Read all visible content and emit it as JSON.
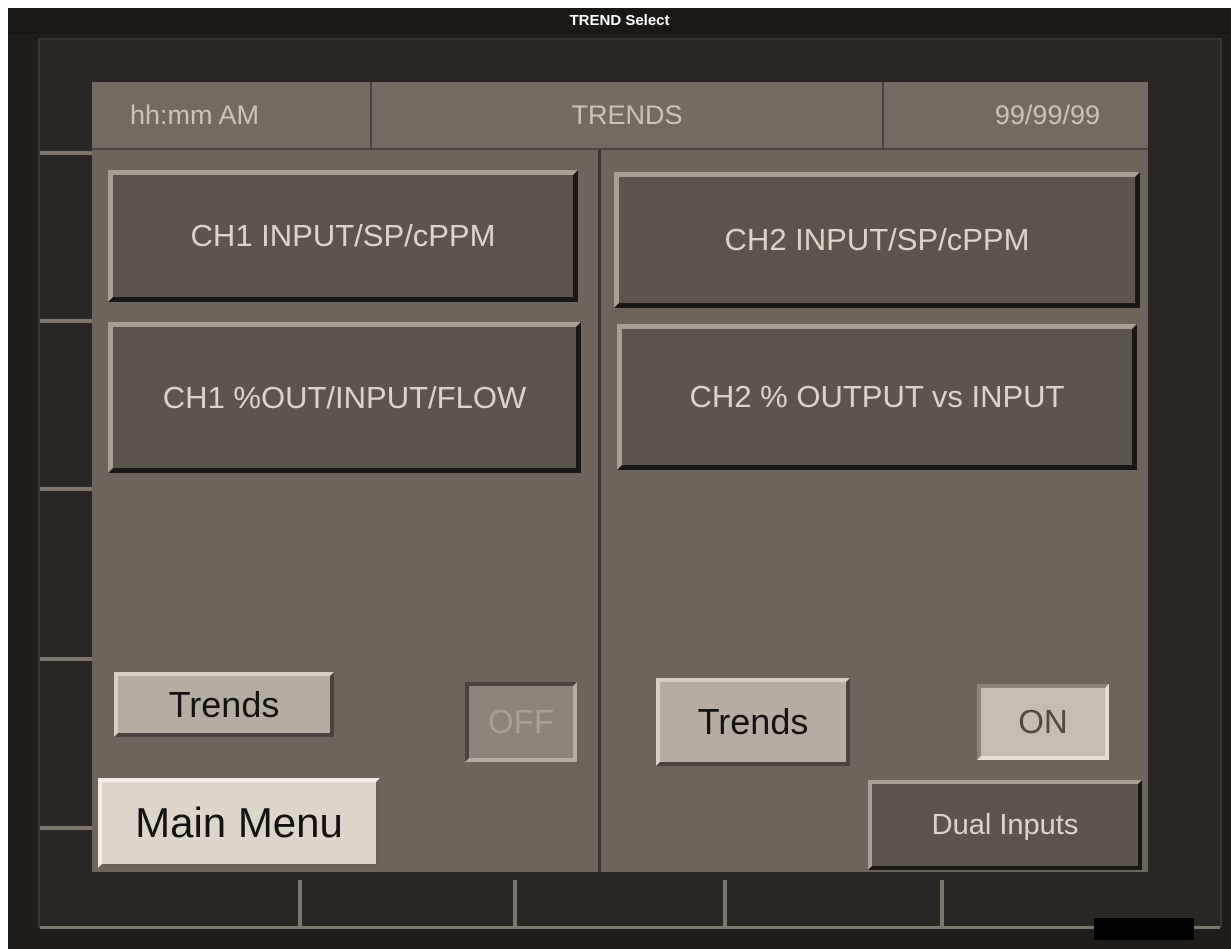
{
  "window": {
    "title": "TREND Select"
  },
  "header": {
    "time": "hh:mm AM",
    "title": "TRENDS",
    "date": "99/99/99"
  },
  "ch1": {
    "btn_input": "CH1 INPUT/SP/cPPM",
    "btn_output": "CH1 %OUT/INPUT/FLOW",
    "trends_label": "Trends",
    "toggle": "OFF"
  },
  "ch2": {
    "btn_input": "CH2 INPUT/SP/cPPM",
    "btn_output": "CH2 % OUTPUT vs INPUT",
    "trends_label": "Trends",
    "toggle": "ON"
  },
  "footer": {
    "main_menu": "Main Menu",
    "dual_inputs": "Dual Inputs"
  },
  "colors": {
    "screen_bg": "#6d655c",
    "bezel_bg": "#2a2623",
    "button_dark": "#5c554e",
    "button_light": "#ddd5ca"
  }
}
